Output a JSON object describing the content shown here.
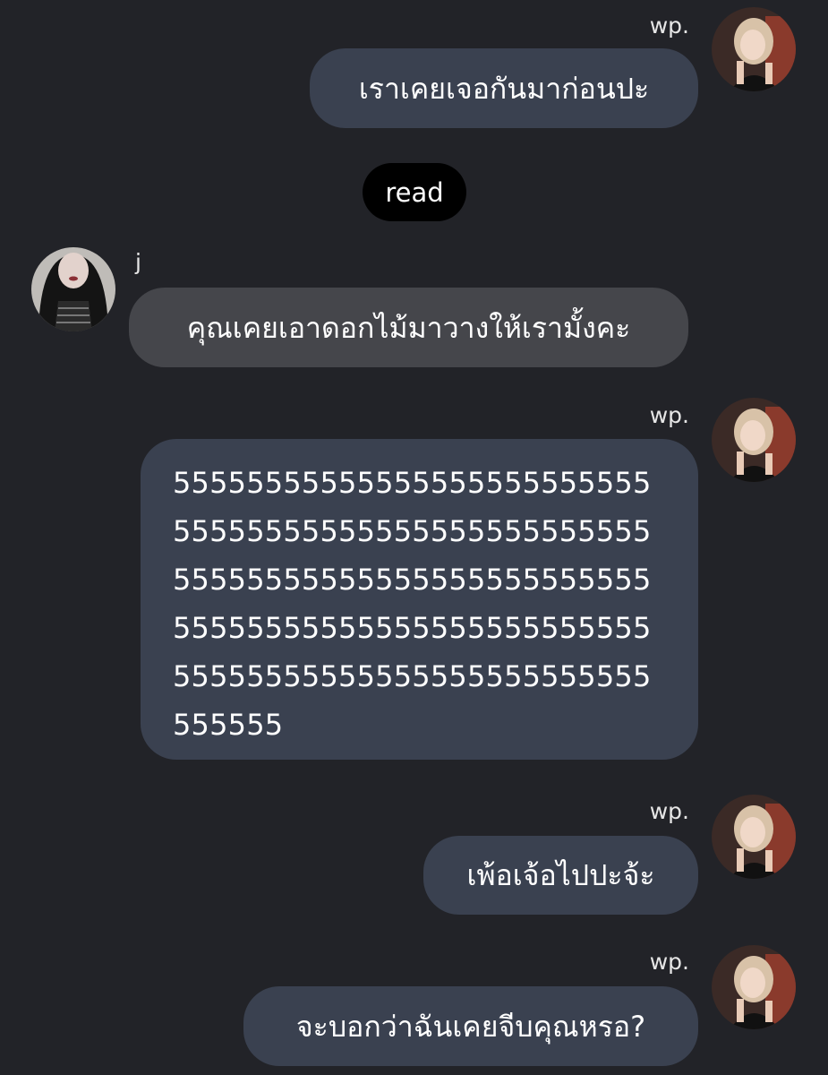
{
  "chat": {
    "read_label": "read",
    "messages": [
      {
        "sender": "wp.",
        "direction": "out",
        "text": "เราเคยเจอกันมาก่อนปะ"
      },
      {
        "sender": "j",
        "direction": "in",
        "text": "คุณเคยเอาดอกไม้มาวางให้เรามั้งคะ"
      },
      {
        "sender": "wp.",
        "direction": "out",
        "text": "5555555555555555555555555555555555555555555555555555555555555555555555555555555555555555555555555555555555555555555555555555555555555555"
      },
      {
        "sender": "wp.",
        "direction": "out",
        "text": "เพ้อเจ้อไปปะจ้ะ"
      },
      {
        "sender": "wp.",
        "direction": "out",
        "text": "จะบอกว่าฉันเคยจีบคุณหรอ?"
      }
    ]
  },
  "colors": {
    "background": "#222328",
    "outgoing_bubble": "#3a4150",
    "incoming_bubble": "#45464b",
    "read_pill": "#000000",
    "text": "#ffffff"
  }
}
